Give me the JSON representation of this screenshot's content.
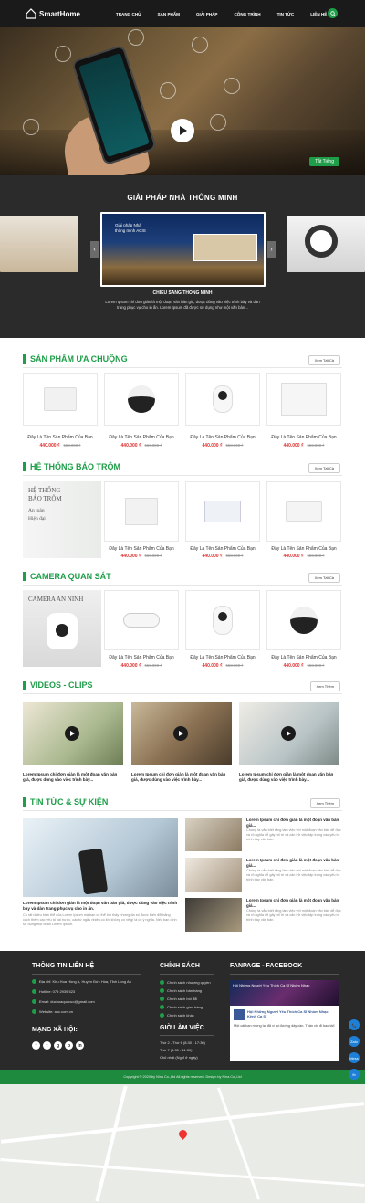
{
  "brand": {
    "name": "SmartHome"
  },
  "nav": {
    "items": [
      "TRANG CHỦ",
      "SẢN PHẨM",
      "GIẢI PHÁP",
      "CÔNG TRÌNH",
      "TIN TỨC",
      "LIÊN HỆ"
    ]
  },
  "hero": {
    "toggle_label": "Tắt Tiếng"
  },
  "solution": {
    "title": "GIẢI PHÁP NHÀ THÔNG MINH",
    "slide_heading": "Giải pháp Nhà thông minh ACIS",
    "caption": "CHIẾU SÁNG THÔNG MINH",
    "description": "Lorem Ipsum chỉ đơn giản là một đoạn văn bản giả, được dùng vào việc trình bày và dàn trang phục vụ cho in ấn. Lorem Ipsum đã được sử dụng như một văn bản..."
  },
  "featured": {
    "title": "SẢN PHẨM ƯA CHUỘNG",
    "more": "Xem Tất Cả",
    "products": [
      {
        "name": "Đây Là Tên Sản Phẩm Của Bạn",
        "price": "440.000 ₫",
        "old_price": "558.000 ₫"
      },
      {
        "name": "Đây Là Tên Sản Phẩm Của Bạn",
        "price": "440.000 ₫",
        "old_price": "558.000 ₫"
      },
      {
        "name": "Đây Là Tên Sản Phẩm Của Bạn",
        "price": "440.000 ₫",
        "old_price": "558.000 ₫"
      },
      {
        "name": "Đây Là Tên Sản Phẩm Của Bạn",
        "price": "440.000 ₫",
        "old_price": "558.000 ₫"
      }
    ]
  },
  "alarm": {
    "title": "HỆ THỐNG BÁO TRỘM",
    "more": "Xem Tất Cả",
    "banner": [
      "HỆ THỐNG",
      "BÁO TRỘM",
      "An toàn",
      "Hiện đại"
    ],
    "products": [
      {
        "name": "Đây Là Tên Sản Phẩm Của Bạn",
        "price": "440.000 ₫",
        "old_price": "558.000 ₫"
      },
      {
        "name": "Đây Là Tên Sản Phẩm Của Bạn",
        "price": "440.000 ₫",
        "old_price": "558.000 ₫"
      },
      {
        "name": "Đây Là Tên Sản Phẩm Của Bạn",
        "price": "440.000 ₫",
        "old_price": "558.000 ₫"
      }
    ]
  },
  "camera": {
    "title": "CAMERA QUAN SÁT",
    "more": "Xem Tất Cả",
    "banner": [
      "CAMERA AN NINH"
    ],
    "products": [
      {
        "name": "Đây Là Tên Sản Phẩm Của Bạn",
        "price": "440.000 ₫",
        "old_price": "558.000 ₫"
      },
      {
        "name": "Đây Là Tên Sản Phẩm Của Bạn",
        "price": "440.000 ₫",
        "old_price": "558.000 ₫"
      },
      {
        "name": "Đây Là Tên Sản Phẩm Của Bạn",
        "price": "440.000 ₫",
        "old_price": "558.000 ₫"
      }
    ]
  },
  "videos": {
    "title": "VIDEOS - CLIPS",
    "more": "Xem Thêm",
    "items": [
      {
        "caption": "Lorem Ipsum chỉ đơn giản là một đoạn văn bản giả, được dùng vào việc trình bày..."
      },
      {
        "caption": "Lorem Ipsum chỉ đơn giản là một đoạn văn bản giả, được dùng vào việc trình bày..."
      },
      {
        "caption": "Lorem Ipsum chỉ đơn giản là một đoạn văn bản giả, được dùng vào việc trình bày..."
      }
    ]
  },
  "news": {
    "title": "TIN TỨC & SỰ KIỆN",
    "more": "Xem Thêm",
    "main": {
      "title": "Lorem Ipsum chỉ đơn giản là một đoạn văn bản giả, được dùng vào việc trình bày và dàn trang phục vụ cho in ấn.",
      "desc": "Có rất nhiều biến thể của Lorem Ipsum mà bạn có thể tìm thấy nhưng đa số được biến đổi bằng cách thêm các yếu tố hài hước, các từ ngẫu nhiên có khi không có vẻ gì là có ý nghĩa. Nếu bạn định sử dụng một đoạn Lorem Ipsum."
    },
    "items": [
      {
        "title": "Lorem Ipsum chỉ đơn giản là một đoạn văn bản giả...",
        "desc": "Chúng ta vẫn biết rằng làm việc với một đoạn văn bản dễ đọc và rõ nghĩa dễ gây rối trí và cản trở việc tập trung vào yếu tố trình bày văn bản."
      },
      {
        "title": "Lorem Ipsum chỉ đơn giản là một đoạn văn bản giả...",
        "desc": "Chúng ta vẫn biết rằng làm việc với một đoạn văn bản dễ đọc và rõ nghĩa dễ gây rối trí và cản trở việc tập trung vào yếu tố trình bày văn bản."
      },
      {
        "title": "Lorem Ipsum chỉ đơn giản là một đoạn văn bản giả...",
        "desc": "Chúng ta vẫn biết rằng làm việc với một đoạn văn bản dễ đọc và rõ nghĩa dễ gây rối trí và cản trở việc tập trung vào yếu tố trình bày văn bản."
      }
    ]
  },
  "footer": {
    "contact_title": "THÔNG TIN LIÊN HỆ",
    "address": "Địa chỉ: Khu Hoa Hồng A, Huyện Đức Hòa, Tỉnh Long An",
    "phone": "Hotline: 079 2939 523",
    "email": "Email: duchoaquocuo@gmail.com",
    "website": "Website: abc.com.vn",
    "social_title": "MẠNG XÃ HỘI:",
    "social_icons": [
      "f",
      "t",
      "g",
      "p",
      "in"
    ],
    "policy_title": "CHÍNH SÁCH",
    "policies": [
      "Chính sách nhượng quyền",
      "Chính sách bán hàng",
      "Chính sách bồi đổi",
      "Chính sách giao hàng",
      "Chính sách khác"
    ],
    "hours_title": "GIỜ LÀM VIỆC",
    "hours": [
      "Thứ 2 - Thứ 6 (8:30 - 17:30)",
      "Thứ 7 (8:30 - 11:30)",
      "Chủ nhật (Nghỉ ở ngày)"
    ],
    "fb_title": "FANPAGE - FACEBOOK",
    "fb_page": "Hội Những Người Yêu Thích Ca Sĩ Nhóm Nhạc",
    "fb_post": "Hội Những Người Yêu Thích Ca Sĩ Nhóm Nhạc Kênh Ca Sĩ",
    "fb_text": "Một cái bạn mừng tai đã vi lại đường dây cần. Thân chi đi bao tài!",
    "copyright": "Copyright © 2020 by Nina Co.,Ltd All rights reserved. Design by Nina Co.,Ltd"
  },
  "side_buttons": [
    "📞",
    "Zalo",
    "Mess",
    "fb"
  ]
}
